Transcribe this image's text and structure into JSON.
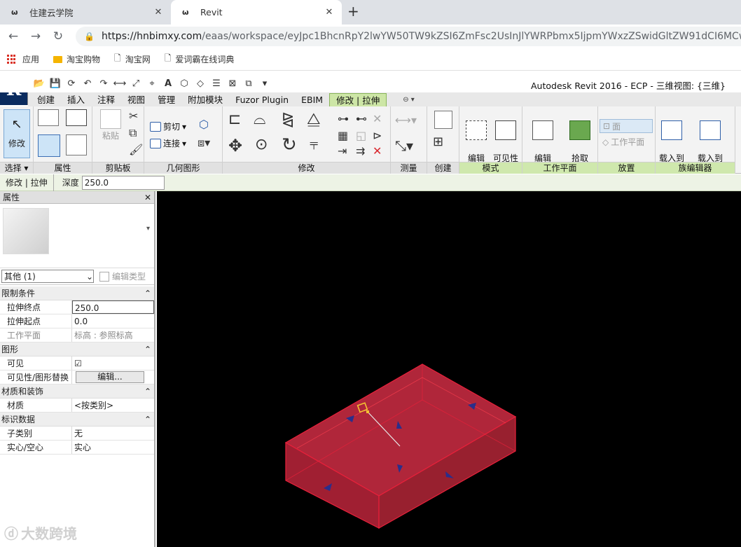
{
  "browser": {
    "tabs": [
      {
        "label": "住建云学院",
        "active": false
      },
      {
        "label": "Revit",
        "active": true
      }
    ],
    "url_host": "https://hnbimxy.com",
    "url_path": "/eaas/workspace/eyJpc1BhcnRpY2lwYW50TW9kZSI6ZmFsc2UsInJlYWRPbmx5IjpmYWxzZSwidGltZW91dCI6MCwidXN",
    "bookmarks": [
      "应用",
      "淘宝购物",
      "淘宝网",
      "爱词霸在线词典"
    ]
  },
  "revit": {
    "app_title": "Autodesk Revit 2016 -     ECP - 三维视图: {三维}",
    "ribbon_tabs": [
      "创建",
      "插入",
      "注释",
      "视图",
      "管理",
      "附加模块",
      "Fuzor Plugin",
      "EBIM",
      "修改 | 拉伸"
    ],
    "active_tab": "修改 | 拉伸",
    "panels": {
      "select": {
        "label": "选择",
        "button": "修改"
      },
      "properties": {
        "label": "属性"
      },
      "clipboard": {
        "label": "剪贴板",
        "paste": "粘贴"
      },
      "geometry": {
        "label": "几何图形",
        "cut": "剪切",
        "join": "连接"
      },
      "modify": {
        "label": "修改"
      },
      "measure": {
        "label": "测量"
      },
      "create": {
        "label": "创建"
      },
      "mode": {
        "label": "模式",
        "edit_extrusion": "编辑\n拉伸",
        "visibility": "可见性\n设置"
      },
      "workplane": {
        "label": "工作平面",
        "edit_workplane": "编辑\n工作平面",
        "pick_new": "拾取\n新的"
      },
      "place": {
        "label": "放置",
        "face": "面",
        "workplane": "工作平面"
      },
      "family_editor": {
        "label": "族编辑器",
        "load_project": "载入到\n项目",
        "load_close": "载入到\n项目并关闭"
      }
    },
    "options_bar": {
      "context": "修改 | 拉伸",
      "depth_label": "深度",
      "depth_value": "250.0"
    }
  },
  "properties": {
    "title": "属性",
    "type_selector": "其他 (1)",
    "edit_type": "编辑类型",
    "groups": [
      {
        "name": "限制条件",
        "rows": [
          {
            "key": "拉伸终点",
            "value": "250.0"
          },
          {
            "key": "拉伸起点",
            "value": "0.0"
          },
          {
            "key": "工作平面",
            "value": "标高 : 参照标高"
          }
        ]
      },
      {
        "name": "图形",
        "rows": [
          {
            "key": "可见",
            "value": "☑"
          },
          {
            "key": "可见性/图形替换",
            "value": "编辑..."
          }
        ]
      },
      {
        "name": "材质和装饰",
        "rows": [
          {
            "key": "材质",
            "value": "<按类别>"
          }
        ]
      },
      {
        "name": "标识数据",
        "rows": [
          {
            "key": "子类别",
            "value": "无"
          },
          {
            "key": "实心/空心",
            "value": "实心"
          }
        ]
      }
    ]
  },
  "watermark": "大数跨境",
  "colors": {
    "viewport_bg": "#000000",
    "extrusion_fill": "#b0263a",
    "extrusion_edge": "#e8203a",
    "ribbon_active": "#cde6a6"
  }
}
